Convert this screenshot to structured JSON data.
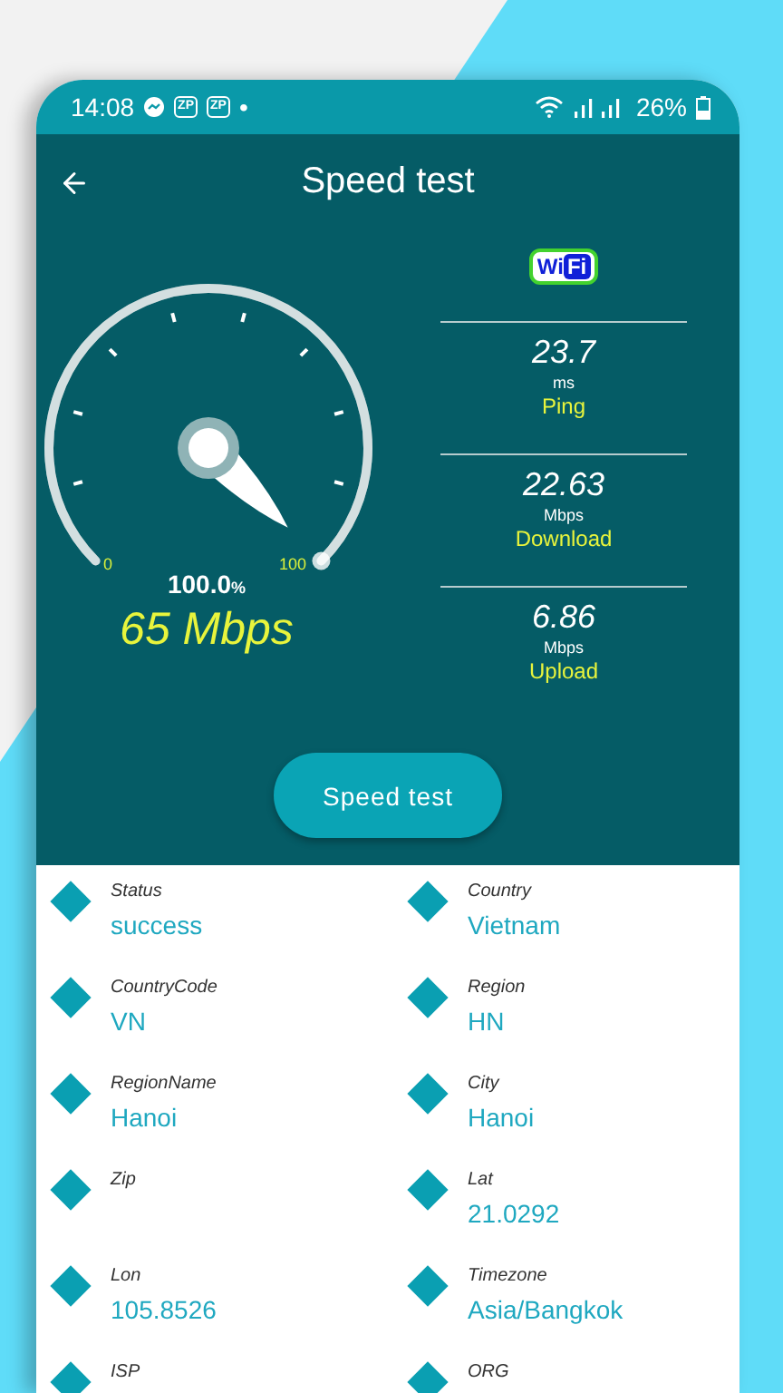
{
  "status_bar": {
    "time": "14:08",
    "badges": [
      "ZP",
      "ZP"
    ],
    "dot": "•",
    "battery": "26%"
  },
  "app_bar": {
    "title": "Speed test"
  },
  "gauge": {
    "level": 1,
    "min": "0",
    "max": "100",
    "percent": "100.0",
    "percent_unit": "%",
    "speed": "65 Mbps"
  },
  "wifi_logo": {
    "left": "Wi",
    "right": "Fi"
  },
  "stats": [
    {
      "value": "23.7",
      "unit": "ms",
      "label": "Ping"
    },
    {
      "value": "22.63",
      "unit": "Mbps",
      "label": "Download"
    },
    {
      "value": "6.86",
      "unit": "Mbps",
      "label": "Upload"
    }
  ],
  "button": "Speed test",
  "info": [
    {
      "label": "Status",
      "value": "success"
    },
    {
      "label": "Country",
      "value": "Vietnam"
    },
    {
      "label": "CountryCode",
      "value": "VN"
    },
    {
      "label": "Region",
      "value": "HN"
    },
    {
      "label": "RegionName",
      "value": "Hanoi"
    },
    {
      "label": "City",
      "value": "Hanoi"
    },
    {
      "label": "Zip"
    },
    {
      "label": "Lat",
      "value": "21.0292"
    },
    {
      "label": "Lon",
      "value": "105.8526"
    },
    {
      "label": "Timezone",
      "value": "Asia/Bangkok"
    },
    {
      "label": "ISP"
    },
    {
      "label": "ORG"
    }
  ]
}
